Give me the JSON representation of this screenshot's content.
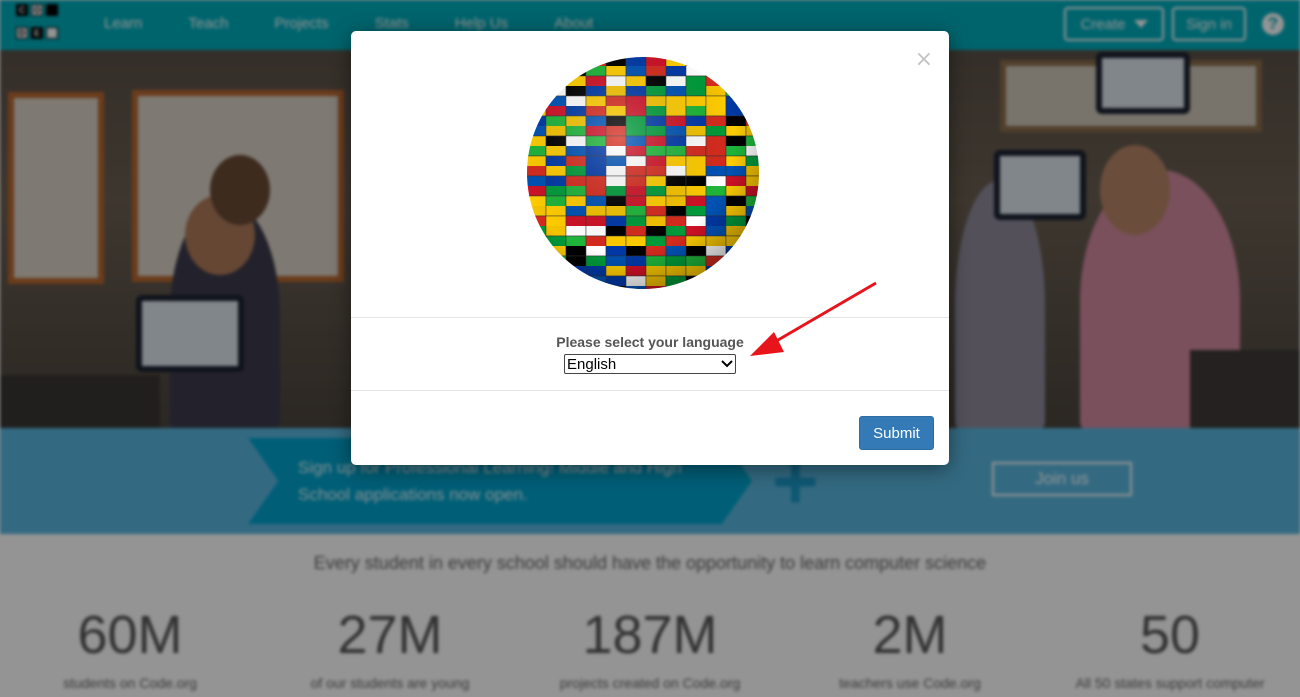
{
  "nav": {
    "logo_letters": [
      "C",
      "O",
      "D",
      "E"
    ],
    "links": [
      "Learn",
      "Teach",
      "Projects",
      "Stats",
      "Help Us",
      "About"
    ],
    "create_label": "Create",
    "signin_label": "Sign in",
    "help_glyph": "?"
  },
  "banner": {
    "text": "Sign up for Professional Learning! Middle and High School applications now open.",
    "join_label": "Join us"
  },
  "tagline": "Every student in every school should have the opportunity to learn computer science",
  "stats": [
    {
      "value": "60M",
      "label": "students on Code.org"
    },
    {
      "value": "27M",
      "label": "of our students are young"
    },
    {
      "value": "187M",
      "label": "projects created on Code.org"
    },
    {
      "value": "2M",
      "label": "teachers use Code.org"
    },
    {
      "value": "50",
      "label": "All 50 states support computer"
    }
  ],
  "modal": {
    "close_glyph": "×",
    "prompt": "Please select your language",
    "selected_language": "English",
    "submit_label": "Submit",
    "image_icon": "flag-globe"
  },
  "colors": {
    "nav": "#00adbc",
    "banner": "#59b7e0",
    "submit": "#337ab7",
    "annotation_arrow": "#e8141c"
  }
}
